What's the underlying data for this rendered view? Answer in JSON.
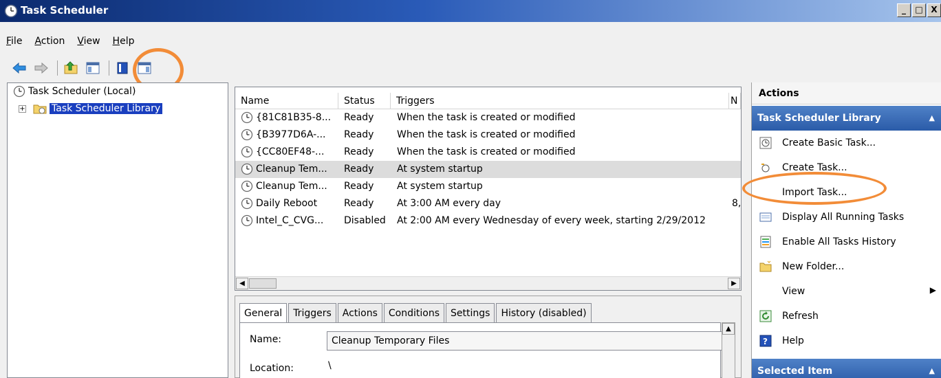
{
  "window": {
    "title": "Task Scheduler",
    "controls": [
      "_",
      "□",
      "X"
    ]
  },
  "menu": {
    "items": [
      {
        "label": "File",
        "accel": "F",
        "rest": "ile"
      },
      {
        "label": "Action",
        "accel": "A",
        "rest": "ction"
      },
      {
        "label": "View",
        "accel": "V",
        "rest": "iew"
      },
      {
        "label": "Help",
        "accel": "H",
        "rest": "elp"
      }
    ]
  },
  "toolbar": {
    "buttons": [
      "back-arrow-icon",
      "forward-arrow-icon",
      "up-folder-icon",
      "show-hide-console-tree-icon",
      "help-book-icon",
      "show-hide-action-pane-icon"
    ]
  },
  "tree": {
    "root_label": "Task Scheduler (Local)",
    "expander": "+",
    "library_label": "Task Scheduler Library"
  },
  "task_list": {
    "columns": [
      "Name",
      "Status",
      "Triggers",
      "N"
    ],
    "rows": [
      {
        "name": "{81C81B35-8...",
        "status": "Ready",
        "trigger": "When the task is created or modified",
        "extra": ""
      },
      {
        "name": "{B3977D6A-...",
        "status": "Ready",
        "trigger": "When the task is created or modified",
        "extra": ""
      },
      {
        "name": "{CC80EF48-...",
        "status": "Ready",
        "trigger": "When the task is created or modified",
        "extra": ""
      },
      {
        "name": "Cleanup Tem...",
        "status": "Ready",
        "trigger": "At system startup",
        "extra": ""
      },
      {
        "name": "Cleanup Tem...",
        "status": "Ready",
        "trigger": "At system startup",
        "extra": ""
      },
      {
        "name": "Daily Reboot",
        "status": "Ready",
        "trigger": "At 3:00 AM every day",
        "extra": "8,"
      },
      {
        "name": "Intel_C_CVG...",
        "status": "Disabled",
        "trigger": "At 2:00 AM every Wednesday of every week, starting 2/29/2012",
        "extra": ""
      }
    ],
    "selected_index": 3
  },
  "details": {
    "tabs": [
      "General",
      "Triggers",
      "Actions",
      "Conditions",
      "Settings",
      "History (disabled)"
    ],
    "active_tab": "General",
    "name_label": "Name:",
    "name_value": "Cleanup Temporary Files",
    "location_label": "Location:",
    "location_value": "\\"
  },
  "actions": {
    "header": "Actions",
    "section_title": "Task Scheduler Library",
    "section_chevron": "▲",
    "items": [
      {
        "label": "Create Basic Task...",
        "icon": "create-basic-task-icon"
      },
      {
        "label": "Create Task...",
        "icon": "create-task-icon"
      },
      {
        "label": "Import Task...",
        "icon": ""
      },
      {
        "label": "Display All Running Tasks",
        "icon": "running-tasks-icon"
      },
      {
        "label": "Enable All Tasks History",
        "icon": "tasks-history-icon"
      },
      {
        "label": "New Folder...",
        "icon": "new-folder-icon"
      },
      {
        "label": "View",
        "icon": "",
        "submenu_arrow": "▶"
      },
      {
        "label": "Refresh",
        "icon": "refresh-icon"
      },
      {
        "label": "Help",
        "icon": "help-icon"
      }
    ],
    "selected_section_title": "Selected Item",
    "selected_section_chevron": "▲"
  },
  "colors": {
    "annotation_orange": "#f28c38",
    "selection_blue": "#1a3fbf",
    "section_header_blue": "#2a5ba8"
  }
}
